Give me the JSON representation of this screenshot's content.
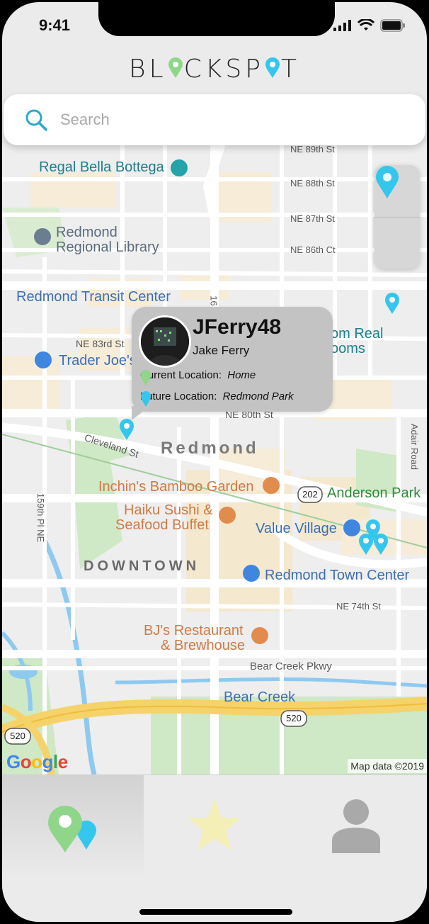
{
  "status": {
    "time": "9:41"
  },
  "app": {
    "logo": "BLOCKSPOT",
    "logo_parts": [
      "BL",
      "CKSP",
      "T"
    ]
  },
  "search": {
    "placeholder": "Search",
    "value": ""
  },
  "map": {
    "streets": [
      "NE 89th St",
      "NE 88th St",
      "NE 87th St",
      "NE 86th Ct",
      "NE 83rd St",
      "NE 80th St",
      "Cleveland St",
      "159th Pl NE",
      "Adair Road",
      "NE 74th St",
      "Bear Creek Pkwy",
      "16"
    ],
    "places": {
      "regal": "Regal Bella Bottega",
      "library_1": "Redmond",
      "library_2": "Regional Library",
      "transit": "Redmond Transit Center",
      "traderjoes": "Trader Joe's",
      "realrooms_1": "om Real",
      "realrooms_2": "ooms",
      "district": "Redmond",
      "inchins": "Inchin's Bamboo Garden",
      "haiku_1": "Haiku Sushi &",
      "haiku_2": "Seafood Buffet",
      "downtown": "DOWNTOWN",
      "value_village": "Value Village",
      "anderson": "Anderson Park",
      "town_center": "Redmond Town Center",
      "bjs_1": "BJ's Restaurant",
      "bjs_2": "& Brewhouse",
      "bear_creek": "Bear Creek"
    },
    "shields": [
      "202",
      "520",
      "520"
    ],
    "attribution": "Map data ©2019",
    "google": [
      "G",
      "o",
      "o",
      "g",
      "l",
      "e"
    ]
  },
  "popup": {
    "username": "JFerry48",
    "name": "Jake Ferry",
    "current_label": "Current Location:",
    "current_value": "Home",
    "future_label": "Future Location:",
    "future_value": "Redmond Park"
  },
  "colors": {
    "green_pin": "#8fd68a",
    "blue_pin": "#35c6ee",
    "accent": "#2aa8c9"
  },
  "tabs": [
    {
      "id": "map",
      "icon": "pins-icon",
      "active": true
    },
    {
      "id": "favorites",
      "icon": "star-icon",
      "active": false
    },
    {
      "id": "profile",
      "icon": "user-icon",
      "active": false
    }
  ]
}
